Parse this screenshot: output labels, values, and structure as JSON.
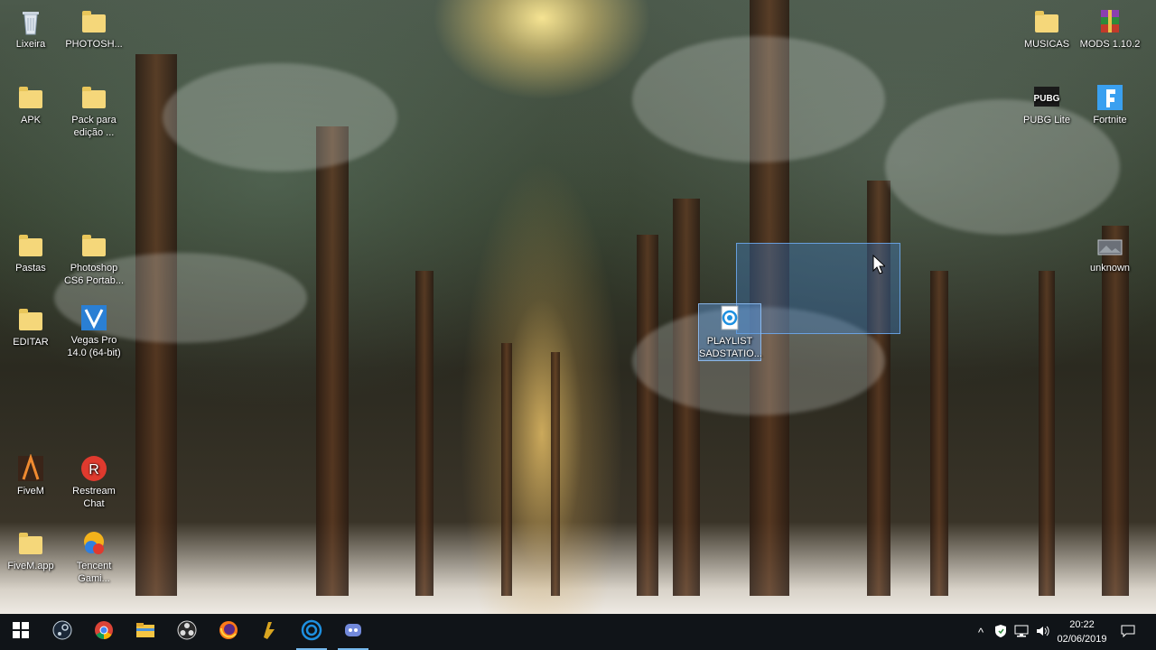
{
  "desktop": {
    "icons": [
      {
        "label": "Lixeira",
        "icon": "recycle-bin-icon"
      },
      {
        "label": "PHOTOSH...",
        "icon": "folder-icon"
      },
      {
        "label": "APK",
        "icon": "folder-icon"
      },
      {
        "label": "Pack para\nedição ...",
        "icon": "folder-icon"
      },
      {
        "label": "Pastas",
        "icon": "folder-icon"
      },
      {
        "label": "Photoshop\nCS6 Portab...",
        "icon": "folder-icon"
      },
      {
        "label": "EDITAR",
        "icon": "folder-icon"
      },
      {
        "label": "Vegas Pro\n14.0 (64-bit)",
        "icon": "vegas-pro-icon"
      },
      {
        "label": "FiveM",
        "icon": "fivem-icon"
      },
      {
        "label": "Restream\nChat",
        "icon": "restream-icon"
      },
      {
        "label": "FiveM.app",
        "icon": "folder-icon"
      },
      {
        "label": "Tencent\nGami...",
        "icon": "tencent-gaming-icon"
      },
      {
        "label": "MUSICAS",
        "icon": "folder-icon"
      },
      {
        "label": "MODS 1.10.2",
        "icon": "winrar-archive-icon"
      },
      {
        "label": "PUBG Lite",
        "icon": "pubg-lite-icon"
      },
      {
        "label": "Fortnite",
        "icon": "fortnite-icon"
      },
      {
        "label": "unknown",
        "icon": "image-file-icon"
      },
      {
        "label": "PLAYLIST\nSADSTATIO...",
        "icon": "playlist-file-icon"
      }
    ]
  },
  "taskbar": {
    "apps": [
      "start-icon",
      "steam-icon",
      "chrome-icon",
      "file-explorer-icon",
      "obs-icon",
      "firefox-icon",
      "blitz-icon",
      "playlist-app-icon",
      "discord-icon"
    ],
    "tray": {
      "chevron": "^",
      "time": "20:22",
      "date": "02/06/2019"
    }
  },
  "colors": {
    "taskbar": "#101418",
    "accent": "#76b9ed",
    "selection": "#3c82d2"
  }
}
